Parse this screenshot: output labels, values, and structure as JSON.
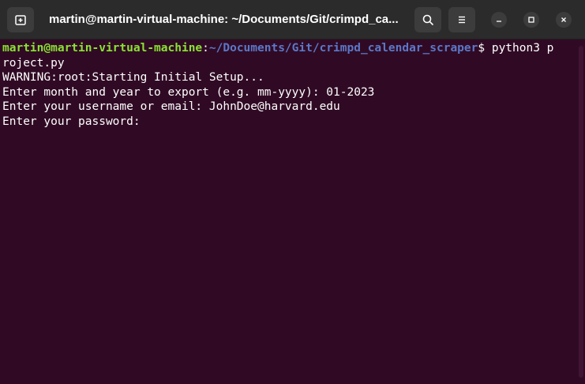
{
  "window": {
    "title": "martin@martin-virtual-machine: ~/Documents/Git/crimpd_ca..."
  },
  "titlebar": {
    "new_tab_icon": "new-tab-icon",
    "search_icon": "search-icon",
    "menu_icon": "hamburger-menu-icon",
    "minimize_icon": "minimize-icon",
    "maximize_icon": "maximize-icon",
    "close_icon": "close-icon"
  },
  "terminal": {
    "prompt_user": "martin@martin-virtual-machine",
    "prompt_colon": ":",
    "prompt_path": "~/Documents/Git/crimpd_calendar_scraper",
    "prompt_symbol": "$",
    "command_start": " python3 p",
    "command_wrap": "roject.py",
    "lines": [
      "WARNING:root:Starting Initial Setup...",
      "Enter month and year to export (e.g. mm-yyyy): 01-2023",
      "Enter your username or email: JohnDoe@harvard.edu",
      "Enter your password:"
    ]
  },
  "colors": {
    "terminal_background": "#300a24",
    "titlebar_background": "#2b2b2b",
    "prompt_user": "#8ae234",
    "prompt_path": "#5b78c8",
    "text": "#ffffff"
  }
}
